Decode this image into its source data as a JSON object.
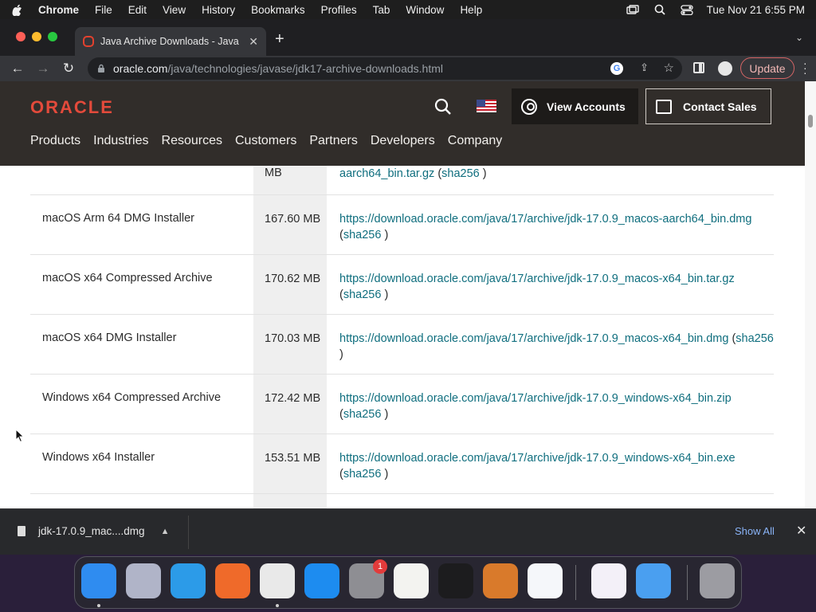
{
  "menubar": {
    "app": "Chrome",
    "items": [
      "File",
      "Edit",
      "View",
      "History",
      "Bookmarks",
      "Profiles",
      "Tab",
      "Window",
      "Help"
    ],
    "clock": "Tue Nov 21  6:55 PM"
  },
  "browser": {
    "tab_title": "Java Archive Downloads - Java",
    "url_host": "oracle.com",
    "url_path": "/java/technologies/javase/jdk17-archive-downloads.html",
    "update_label": "Update"
  },
  "site": {
    "logo": "ORACLE",
    "view_accounts": "View Accounts",
    "contact_sales": "Contact Sales",
    "nav": [
      "Products",
      "Industries",
      "Resources",
      "Customers",
      "Partners",
      "Developers",
      "Company"
    ]
  },
  "downloads": {
    "rows": [
      {
        "product": "",
        "size": "MB",
        "link": "aarch64_bin.tar.gz",
        "checksum": "sha256"
      },
      {
        "product": "macOS Arm 64 DMG Installer",
        "size": "167.60 MB",
        "link": "https://download.oracle.com/java/17/archive/jdk-17.0.9_macos-aarch64_bin.dmg",
        "checksum": "sha256"
      },
      {
        "product": "macOS x64 Compressed Archive",
        "size": "170.62 MB",
        "link": "https://download.oracle.com/java/17/archive/jdk-17.0.9_macos-x64_bin.tar.gz",
        "checksum": "sha256"
      },
      {
        "product": "macOS x64 DMG Installer",
        "size": "170.03 MB",
        "link": "https://download.oracle.com/java/17/archive/jdk-17.0.9_macos-x64_bin.dmg",
        "checksum": "sha256"
      },
      {
        "product": "Windows x64 Compressed Archive",
        "size": "172.42 MB",
        "link": "https://download.oracle.com/java/17/archive/jdk-17.0.9_windows-x64_bin.zip",
        "checksum": "sha256"
      },
      {
        "product": "Windows x64 Installer",
        "size": "153.51 MB",
        "link": "https://download.oracle.com/java/17/archive/jdk-17.0.9_windows-x64_bin.exe",
        "checksum": "sha256"
      }
    ]
  },
  "download_bar": {
    "file": "jdk-17.0.9_mac....dmg",
    "show_all": "Show All"
  },
  "dock": {
    "apps": [
      {
        "name": "finder-icon",
        "color": "#2f8cf0",
        "running": true
      },
      {
        "name": "launchpad-icon",
        "color": "#b0b4c8",
        "running": false
      },
      {
        "name": "safari-icon",
        "color": "#2c9be8",
        "running": false
      },
      {
        "name": "firefox-icon",
        "color": "#ef6a2a",
        "running": false
      },
      {
        "name": "chrome-icon",
        "color": "#e9e9e9",
        "running": true
      },
      {
        "name": "app-store-icon",
        "color": "#1d8cf0",
        "running": false
      },
      {
        "name": "system-settings-icon",
        "color": "#8e8e93",
        "running": false,
        "badge": "1"
      },
      {
        "name": "textedit-icon",
        "color": "#f3f3f0",
        "running": false
      },
      {
        "name": "terminal-icon",
        "color": "#1c1c1e",
        "running": false
      },
      {
        "name": "garageband-icon",
        "color": "#d97a2b",
        "running": false
      },
      {
        "name": "vscode-icon",
        "color": "#f5f7fa",
        "running": false
      },
      {
        "name": "visual-studio-icon",
        "color": "#f3f0f8",
        "running": false
      },
      {
        "name": "weather-icon",
        "color": "#4a9ff0",
        "running": false
      },
      {
        "name": "trash-icon",
        "color": "#9c9ca2",
        "running": false
      }
    ]
  },
  "colors": {
    "oracle_red": "#e34a3b",
    "oracle_header": "#312d2a",
    "link": "#0f6e7e"
  }
}
